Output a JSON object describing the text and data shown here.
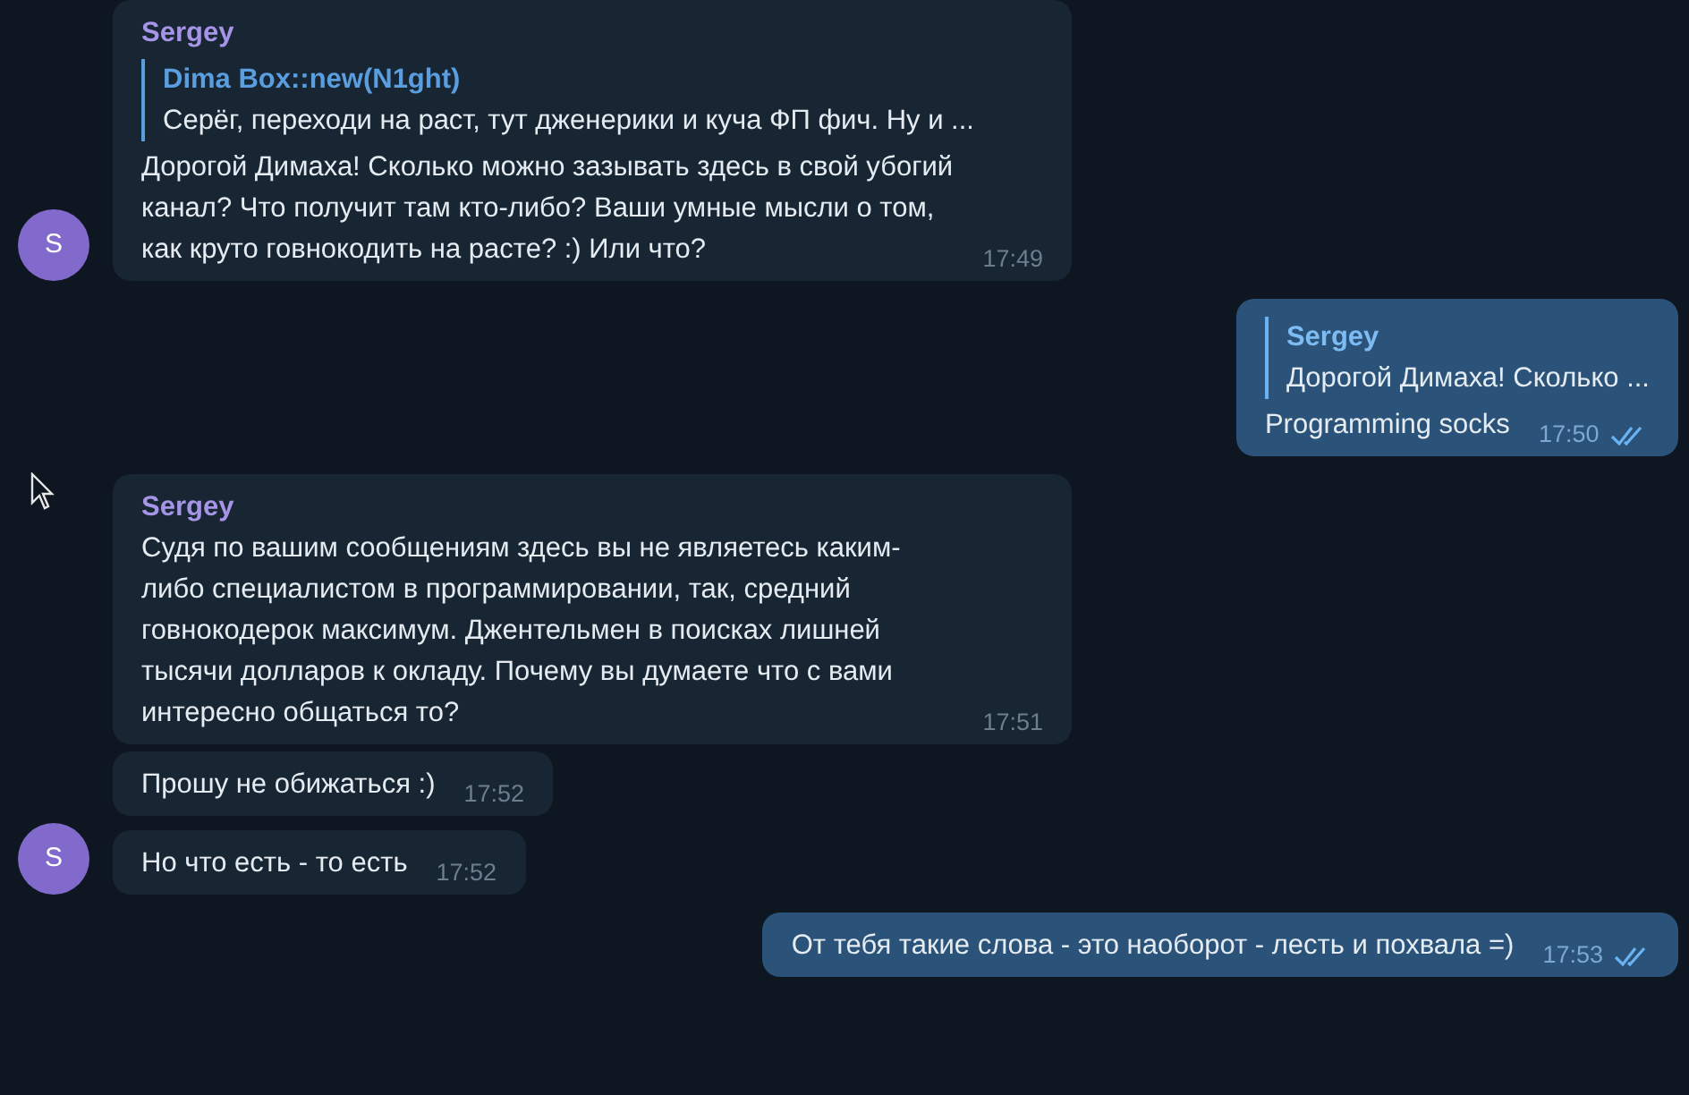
{
  "messages": [
    {
      "kind": "incoming",
      "sender": "Sergey",
      "reply": {
        "name": "Dima Box::new(N1ght)",
        "text": "Серёг, переходи на раст, тут дженерики и куча ФП фич. Ну и ..."
      },
      "text": "Дорогой Димаха! Сколько можно зазывать здесь в свой убогий канал? Что получит там кто-либо? Ваши умные мысли о том, как круто говнокодить на расте? :) Или что?",
      "time": "17:49",
      "avatar": "S"
    },
    {
      "kind": "outgoing",
      "reply": {
        "name": "Sergey",
        "text": "Дорогой Димаха! Сколько ..."
      },
      "text": "Programming socks",
      "time": "17:50",
      "read": true
    },
    {
      "kind": "incoming",
      "sender": "Sergey",
      "text": "Судя по вашим сообщениям здесь вы не являетесь каким-либо специалистом в программировании, так, средний говнокодерок максимум. Джентельмен в поисках лишней тысячи долларов к окладу. Почему вы думаете что с вами интересно общаться то?",
      "time": "17:51"
    },
    {
      "kind": "incoming",
      "text": "Прошу не обижаться :)",
      "time": "17:52"
    },
    {
      "kind": "incoming",
      "text": "Но что есть - то есть",
      "time": "17:52",
      "avatar": "S"
    },
    {
      "kind": "outgoing",
      "text": "От тебя такие слова - это наоборот - лесть и похвала =)",
      "time": "17:53",
      "read": true
    }
  ]
}
